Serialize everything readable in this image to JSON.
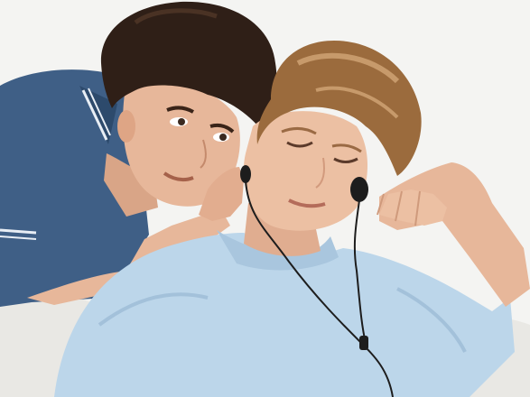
{
  "scene": {
    "palette": {
      "background": "#f4f4f2",
      "left_shirt": "#3f5f86",
      "right_shirt": "#bcd6ea",
      "dark_hair": "#2f1f17",
      "light_hair": "#9b6b3d",
      "skin": "#e7b79a",
      "cable": "#1d1d1d"
    },
    "icons": [
      "headphones-icon"
    ]
  }
}
